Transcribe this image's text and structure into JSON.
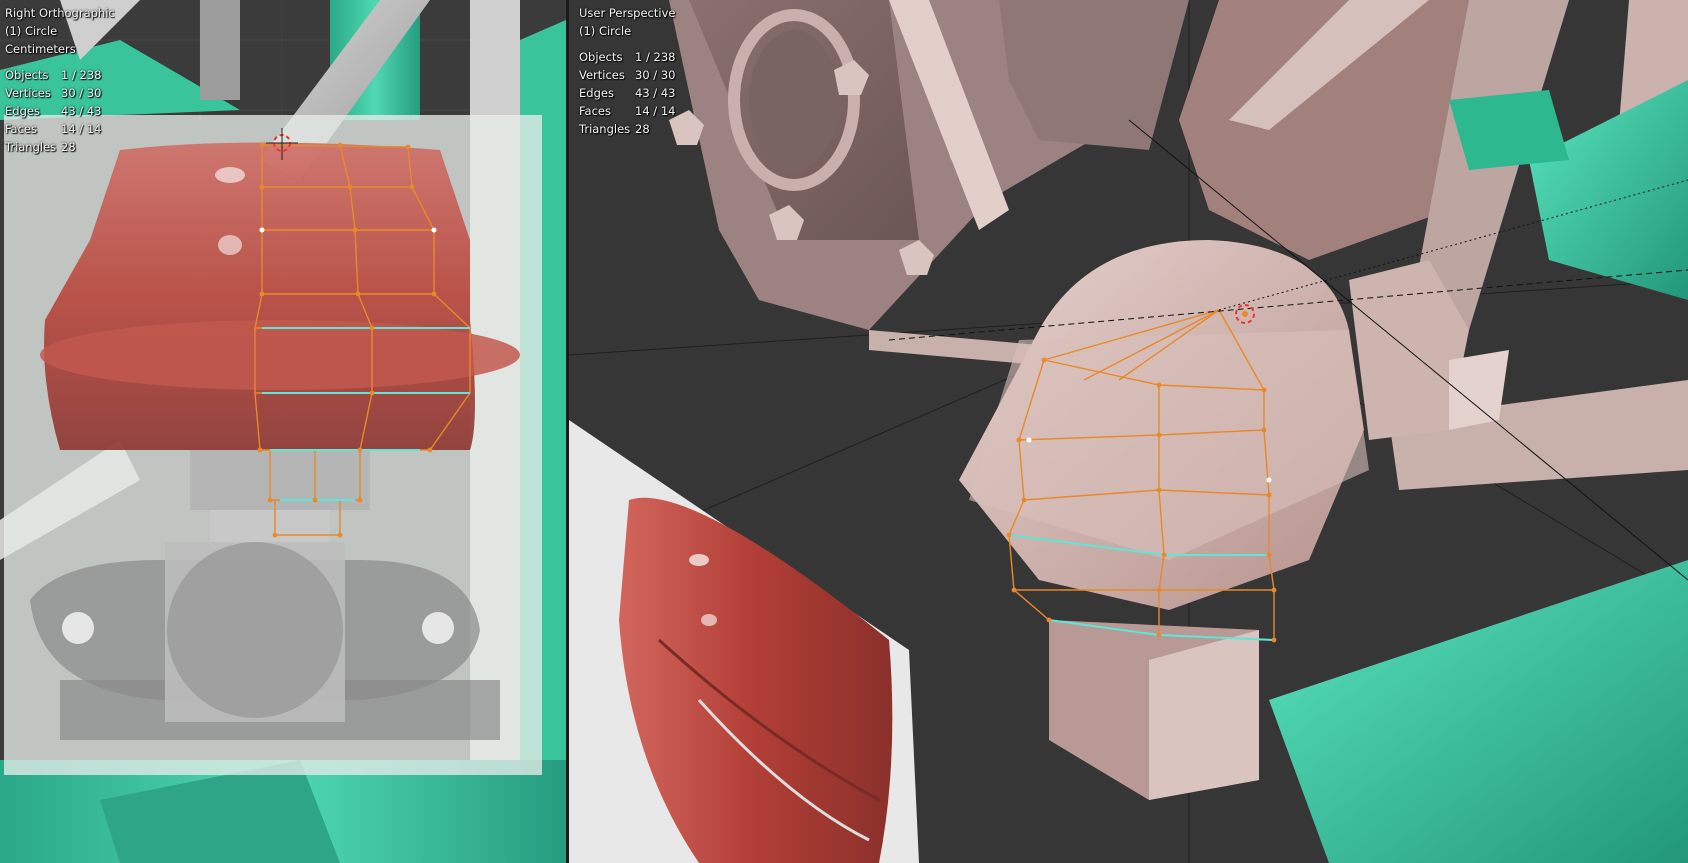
{
  "left_viewport": {
    "view_name": "Right Orthographic",
    "object": "(1) Circle",
    "units": "Centimeters",
    "stats": [
      {
        "label": "Objects",
        "value": "1 / 238"
      },
      {
        "label": "Vertices",
        "value": "30 / 30"
      },
      {
        "label": "Edges",
        "value": "43 / 43"
      },
      {
        "label": "Faces",
        "value": "14 / 14"
      },
      {
        "label": "Triangles",
        "value": "28"
      }
    ]
  },
  "right_viewport": {
    "view_name": "User Perspective",
    "object": "(1) Circle",
    "stats": [
      {
        "label": "Objects",
        "value": "1 / 238"
      },
      {
        "label": "Vertices",
        "value": "30 / 30"
      },
      {
        "label": "Edges",
        "value": "43 / 43"
      },
      {
        "label": "Faces",
        "value": "14 / 14"
      },
      {
        "label": "Triangles",
        "value": "28"
      }
    ]
  },
  "colors": {
    "background": "#3a3a3a",
    "mesh_model": "#c9aaa6",
    "teal_model": "#35c79e",
    "wire_edge": "#e8892a",
    "selected_edge": "#5ee6d8",
    "reference_red": "#b8463c"
  },
  "icons": {
    "cursor_3d": "3d-cursor-icon"
  }
}
